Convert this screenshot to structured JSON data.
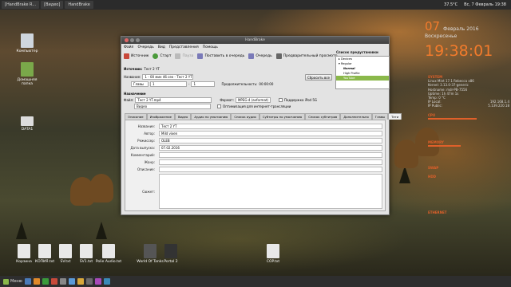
{
  "topbar": {
    "tasks": [
      "[HandBrake R...",
      "[Видео]",
      "HandBrake"
    ],
    "temp": "37.5°C",
    "datetime": "Вс, 7 Февраль 19:38"
  },
  "desktop_icons": [
    "Компьютер",
    "Домашняя папка",
    "DATA1",
    "Корзина",
    "КОПИЯ.txt",
    "SV.txt",
    "SV1.txt",
    "Polie Audio.txt",
    "World Of Tanks",
    "Portal 2",
    "COP.txt"
  ],
  "clock": {
    "day": "07",
    "month": "Февраль 2016",
    "weekday": "Воскресенье",
    "time": "19:38:01"
  },
  "sysmon": {
    "system": "SYSTEM",
    "version": "Linux Mint 17.1 Rebecca x86",
    "kernel": "Kernel: 3.13.0-37-generic",
    "hostname": "Hostname: mdr-PB-7556",
    "uptime": "Uptime: 1h 47m 1s",
    "temp": "Temp: 0 °C",
    "ip_local": "192.168.1.4",
    "ip_public": "5.139.220.18",
    "cpu_label": "CPU",
    "mem_label": "MEMORY",
    "swap_label": "SWAP",
    "hdd_label": "HDD",
    "eth_label": "ETHERNET"
  },
  "window": {
    "title": "HandBrake",
    "menu": [
      "Файл",
      "Очередь",
      "Вид",
      "Представления",
      "Помощь"
    ],
    "toolbar": [
      "Источник",
      "Старт",
      "Пауза",
      "Поставить в очередь",
      "Очередь",
      "Предварительный просмотр"
    ],
    "source_label": "Источник:",
    "source_value": "Тест 2 YT",
    "title_label": "Название:",
    "title_value": "1 - 00 мин 46 сек - Тест 2 YT",
    "angle_label": "Угол:",
    "angle_value": "1",
    "chapters_label": "Главы",
    "chapter_from": "1",
    "chapter_to": "1",
    "duration_label": "Продолжительность:",
    "duration_value": "00:00:00",
    "reset_button": "Сбросить все",
    "dest_label": "Назначение",
    "file_label": "Файл:",
    "file_value": "Тест 2 YT.mp4",
    "folder_value": "Видео",
    "format_label": "Формат:",
    "format_value": "MPEG-4 (avformat)",
    "ipod_label": "Поддержка iPod 5G",
    "web_label": "Оптимизация для интернет-трансляции",
    "presets_header": "Список предустановки",
    "presets": [
      "▸ Devices",
      "▾ Regular",
      "Normal",
      "High Profile",
      "YouTube"
    ],
    "tabs": [
      "Описание",
      "Изображение",
      "Видео",
      "Аудио по умолчанию",
      "Список аудио",
      "Субтитры по умолчанию",
      "Список субтитров",
      "Дополнительно",
      "Главы",
      "Теги"
    ],
    "tags": [
      {
        "label": "Название:",
        "value": "Тест 2 YT"
      },
      {
        "label": "Автор:",
        "value": "Mild vixen"
      },
      {
        "label": "Режиссер:",
        "value": "OLEB"
      },
      {
        "label": "Дата выпуска:",
        "value": "07.02.2016"
      },
      {
        "label": "Комментарий:",
        "value": ""
      },
      {
        "label": "Жанр:",
        "value": ""
      },
      {
        "label": "Описание:",
        "value": ""
      }
    ],
    "plot_label": "Сюжет:"
  },
  "dock": {
    "menu": "Меню"
  }
}
